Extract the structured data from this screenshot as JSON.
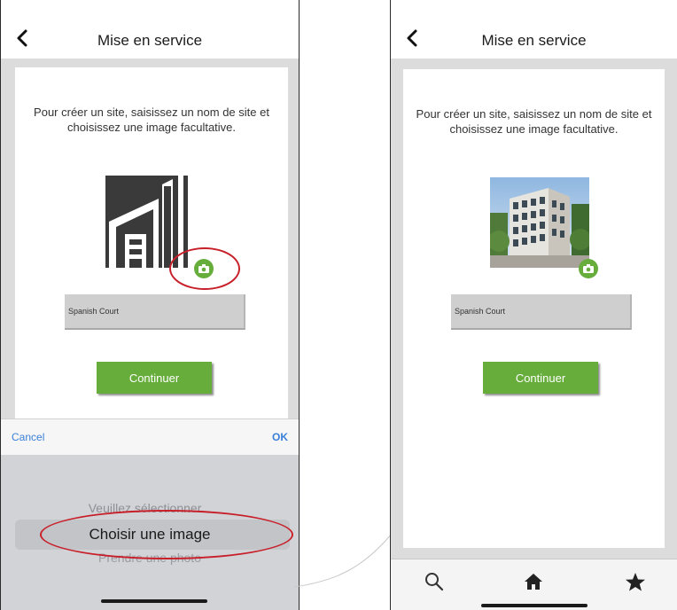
{
  "left_screen": {
    "header": {
      "title": "Mise en service"
    },
    "instruction": "Pour créer un site, saisissez un nom de site et choisissez une image facultative.",
    "site_name_value": "Spanish Court",
    "continue_label": "Continuer",
    "toolbar": {
      "cancel_label": "Cancel",
      "ok_label": "OK"
    },
    "picker": {
      "options": [
        "Veuillez sélectionner...",
        "Choisir une image",
        "Prendre une photo"
      ],
      "selected": "Choisir une image"
    }
  },
  "right_screen": {
    "header": {
      "title": "Mise en service"
    },
    "instruction": "Pour créer un site, saisissez un nom de site et choisissez une image facultative.",
    "site_name_value": "Spanish Court",
    "continue_label": "Continuer",
    "tabbar": {
      "icons": [
        "search-icon",
        "home-icon",
        "star-icon"
      ]
    }
  },
  "colors": {
    "accent_green": "#67ad3b",
    "highlight_red": "#c8202a",
    "link_blue": "#3a7fd8"
  }
}
